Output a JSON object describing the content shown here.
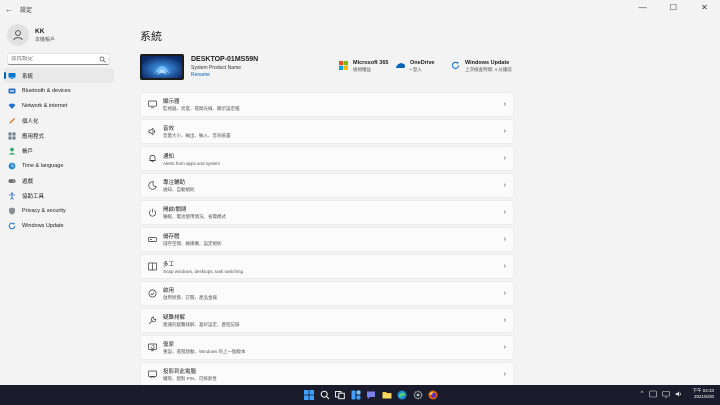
{
  "window": {
    "title": "設定",
    "back_glyph": "←",
    "controls": [
      "—",
      "☐",
      "✕"
    ]
  },
  "sidebar": {
    "user": {
      "name": "KK",
      "account": "本機帳戶"
    },
    "search": {
      "placeholder": "尋找設定"
    },
    "items": [
      {
        "label": "系統",
        "icon": "system-icon",
        "selected": true
      },
      {
        "label": "Bluetooth & devices",
        "icon": "bluetooth-icon"
      },
      {
        "label": "Network & internet",
        "icon": "network-icon"
      },
      {
        "label": "個人化",
        "icon": "personalize-icon"
      },
      {
        "label": "應用程式",
        "icon": "apps-icon"
      },
      {
        "label": "帳戶",
        "icon": "accounts-icon"
      },
      {
        "label": "Time & language",
        "icon": "time-language-icon"
      },
      {
        "label": "遊戲",
        "icon": "gaming-icon"
      },
      {
        "label": "協助工具",
        "icon": "accessibility-icon"
      },
      {
        "label": "Privacy & security",
        "icon": "privacy-icon"
      },
      {
        "label": "Windows Update",
        "icon": "windows-update-icon"
      }
    ]
  },
  "main": {
    "title": "系統",
    "device": {
      "name": "DESKTOP-01MS59N",
      "model": "System Product Name",
      "rename": "Rename"
    },
    "quick": [
      {
        "title": "Microsoft 365",
        "subtitle": "檢視權益",
        "icon": "microsoft365-icon"
      },
      {
        "title": "OneDrive",
        "subtitle": "• 登入",
        "icon": "onedrive-icon"
      },
      {
        "title": "Windows Update",
        "subtitle": "上次檢查時間: 4 分鐘前",
        "icon": "windows-update-icon"
      }
    ],
    "cards": [
      {
        "title": "顯示器",
        "subtitle": "監視器、亮度、夜間光線、顯示設定檔",
        "icon": "display-icon"
      },
      {
        "title": "音效",
        "subtitle": "音量大小、輸出、輸入、音效裝置",
        "icon": "sound-icon"
      },
      {
        "title": "通知",
        "subtitle": "Alerts from apps and system",
        "icon": "notifications-icon"
      },
      {
        "title": "專注輔助",
        "subtitle": "通知、自動規則",
        "icon": "focus-assist-icon"
      },
      {
        "title": "開啟/關閉",
        "subtitle": "睡眠、電池使用情況、省電模式",
        "icon": "power-icon"
      },
      {
        "title": "儲存體",
        "subtitle": "儲存空間、磁碟機、設定規則",
        "icon": "storage-icon"
      },
      {
        "title": "多工",
        "subtitle": "Snap windows, desktops, task switching",
        "icon": "multitasking-icon"
      },
      {
        "title": "啟用",
        "subtitle": "啟用狀態、訂閱、產品金鑰",
        "icon": "activation-icon"
      },
      {
        "title": "疑難排解",
        "subtitle": "建議的疑難排解、喜好設定、歷程記錄",
        "icon": "troubleshoot-icon"
      },
      {
        "title": "復原",
        "subtitle": "重設、進階啟動、Windows 的上一個版本",
        "icon": "recovery-icon"
      },
      {
        "title": "投影到此電腦",
        "subtitle": "權限、配對 PIN、可探索性",
        "icon": "projecting-icon"
      }
    ],
    "chevron": "›"
  },
  "taskbar": {
    "apps": [
      "start-icon",
      "search-icon",
      "task-view-icon",
      "widgets-icon",
      "chat-icon",
      "file-explorer-icon",
      "edge-icon",
      "settings-icon",
      "firefox-icon"
    ],
    "tray_chevron": "^",
    "time": "下午 04:33",
    "date": "2021/6/30"
  },
  "colors": {
    "accent": "#0067c0",
    "taskbar": "#1a1c2c",
    "background": "#f3f3f3"
  }
}
